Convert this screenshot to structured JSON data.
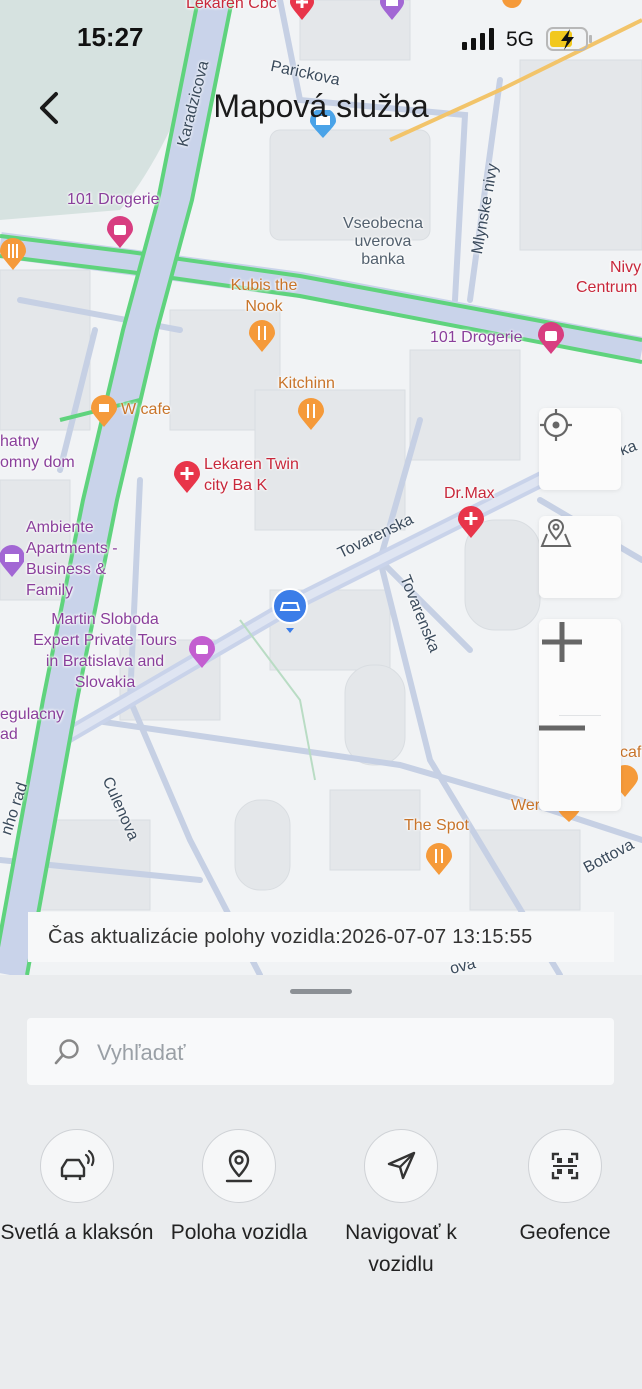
{
  "status_bar": {
    "time": "15:27",
    "network": "5G"
  },
  "header": {
    "title": "Mapová služba"
  },
  "map": {
    "pois": {
      "lekaren_cbc": "Lekaren Cbc",
      "drogerie_1": "101 Drogerie",
      "drogerie_2": "101 Drogerie",
      "kubis_1": "Kubis the",
      "kubis_2": "Nook",
      "kitchinn": "Kitchinn",
      "w_cafe": "W cafe",
      "lekaren_twin_1": "Lekaren Twin",
      "lekaren_twin_2": "city Ba K",
      "drmax": "Dr.Max",
      "ambiente_1": "Ambiente",
      "ambiente_2": "Apartments -",
      "ambiente_3": "Business &",
      "ambiente_4": "Family",
      "martin_1": "Martin Sloboda",
      "martin_2": "Expert Private Tours",
      "martin_3": "in Bratislava and",
      "martin_4": "Slovakia",
      "vseobecna_1": "Vseobecna",
      "vseobecna_2": "uverova",
      "vseobecna_3": "banka",
      "nivy_1": "Nivy",
      "nivy_2": "Centrum",
      "the_spot": "The Spot",
      "wer": "Wer",
      "cafe_right": "caf",
      "hatny": "hatny",
      "omny_dom": "omny dom",
      "egulacny": "egulacny",
      "ad": "ad"
    },
    "streets": {
      "karadzicova": "Karadzicova",
      "parickova": "Parickova",
      "mlynske_nivy": "Mlynske nivy",
      "tovarenska_1": "Tovarenska",
      "tovarenska_2": "Tovarenska",
      "culenova": "Culenova",
      "bottova": "Bottova",
      "nho_rad": "nho rad",
      "ka": "ka",
      "ova": "ova"
    }
  },
  "controls": {
    "locate": "locate-icon",
    "vehicle_location": "map-pin-icon",
    "zoom_in": "plus-icon",
    "zoom_out": "minus-icon"
  },
  "update_time": "Čas aktualizácie polohy vozidla:2026-07-07 13:15:55",
  "search": {
    "placeholder": "Vyhľadať"
  },
  "actions": [
    {
      "label": "Svetlá a klaksón",
      "icon": "car-horn-icon"
    },
    {
      "label": "Poloha vozidla",
      "icon": "location-pin-icon"
    },
    {
      "label": "Navigovať k vozidlu",
      "icon": "navigation-arrow-icon"
    },
    {
      "label": "Geofence",
      "icon": "geofence-icon"
    }
  ],
  "colors": {
    "traffic_green": "#5fd37d",
    "road_blue": "#c9d3ea",
    "vehicle_marker": "#3b7de8",
    "poi_orange": "#f59a3a",
    "poi_red": "#e8354a",
    "poi_purple": "#b35bc9"
  }
}
